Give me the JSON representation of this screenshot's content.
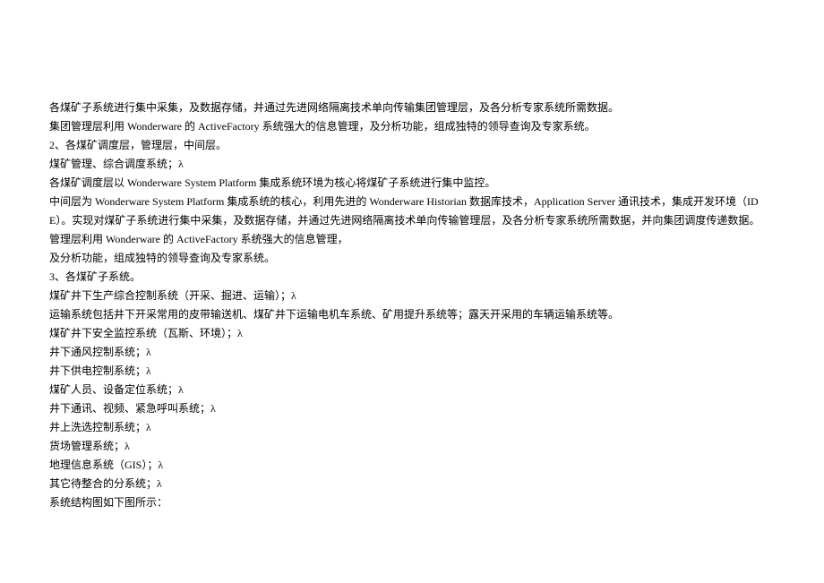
{
  "lines": {
    "l1": "各煤矿子系统进行集中采集，及数据存储，并通过先进网络隔离技术单向传输集团管理层，及各分析专家系统所需数据。",
    "l2": "集团管理层利用 Wonderware 的 ActiveFactory 系统强大的信息管理，及分析功能，组成独特的领导查询及专家系统。",
    "l3": "2、各煤矿调度层，管理层，中间层。",
    "l4": "煤矿管理、综合调度系统；λ",
    "l5": "各煤矿调度层以 Wonderware  System Platform 集成系统环境为核心将煤矿子系统进行集中监控。",
    "l6": "中间层为 Wonderware  System Platform 集成系统的核心，利用先进的 Wonderware Historian 数据库技术，Application Server 通讯技术，集成开发环境（IDE）。实现对煤矿子系统进行集中采集，及数据存储，并通过先进网络隔离技术单向传输管理层，及各分析专家系统所需数据，并向集团调度传递数据。",
    "l7": "管理层利用 Wonderware 的 ActiveFactory 系统强大的信息管理，",
    "l8": "及分析功能，组成独特的领导查询及专家系统。",
    "l9": "3、各煤矿子系统。",
    "l10": "煤矿井下生产综合控制系统（开采、掘进、运输）；λ",
    "l11": "运输系统包括井下开采常用的皮带输送机、煤矿井下运输电机车系统、矿用提升系统等；露天开采用的车辆运输系统等。",
    "l12": "煤矿井下安全监控系统（瓦斯、环境）；λ",
    "l13": "井下通风控制系统；λ",
    "l14": "井下供电控制系统；λ",
    "l15": "煤矿人员、设备定位系统；λ",
    "l16": "井下通讯、视频、紧急呼叫系统；λ",
    "l17": "井上洗选控制系统；λ",
    "l18": "货场管理系统；λ",
    "l19": "地理信息系统（GIS）；λ",
    "l20": "其它待整合的分系统；λ",
    "l21": "系统结构图如下图所示："
  }
}
